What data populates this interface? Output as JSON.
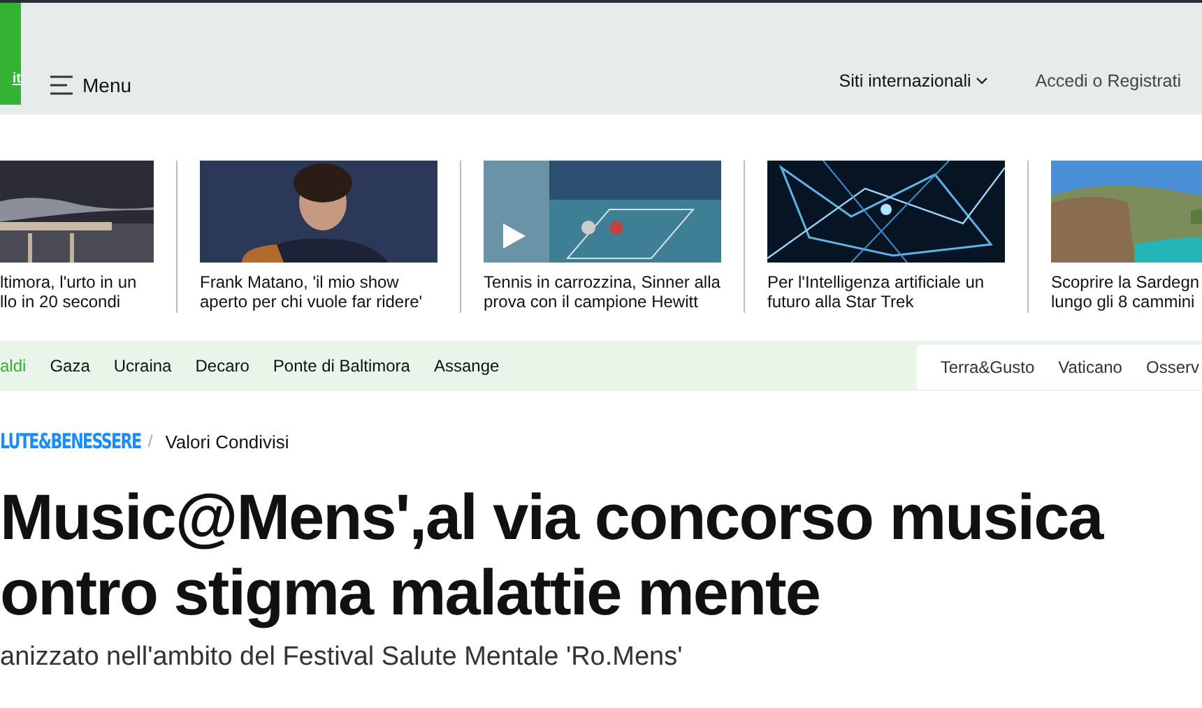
{
  "header": {
    "edition_badge": "it",
    "menu": "Menu",
    "international": "Siti internazionali",
    "login": "Accedi o Registrati"
  },
  "stories": [
    {
      "video": false,
      "title": "ltimora, l'urto in un\nllo in 20 secondi"
    },
    {
      "video": false,
      "title": "Frank Matano, 'il mio show\naperto per chi vuole far ridere'"
    },
    {
      "video": true,
      "title": "Tennis in carrozzina, Sinner alla\nprova con il campione Hewitt"
    },
    {
      "video": false,
      "title": "Per l'Intelligenza artificiale un\nfuturo alla Star Trek"
    },
    {
      "video": false,
      "title": "Scoprire la Sardegn\nlungo gli 8 cammini"
    }
  ],
  "topics": [
    {
      "label": "aldi",
      "selected": true
    },
    {
      "label": "Gaza",
      "selected": false
    },
    {
      "label": "Ucraina",
      "selected": false
    },
    {
      "label": "Decaro",
      "selected": false
    },
    {
      "label": "Ponte di Baltimora",
      "selected": false
    },
    {
      "label": "Assange",
      "selected": false
    }
  ],
  "sections": [
    "Terra&Gusto",
    "Vaticano",
    "Osserv"
  ],
  "breadcrumb": {
    "section": "LUTE&BENESSERE",
    "separator": "/",
    "page": "Valori Condivisi"
  },
  "article": {
    "headline": [
      "Music@Mens',al via concorso musica",
      "ontro stigma malattie mente"
    ],
    "subtitle": "anizzato nell'ambito del Festival Salute Mentale 'Ro.Mens'"
  }
}
